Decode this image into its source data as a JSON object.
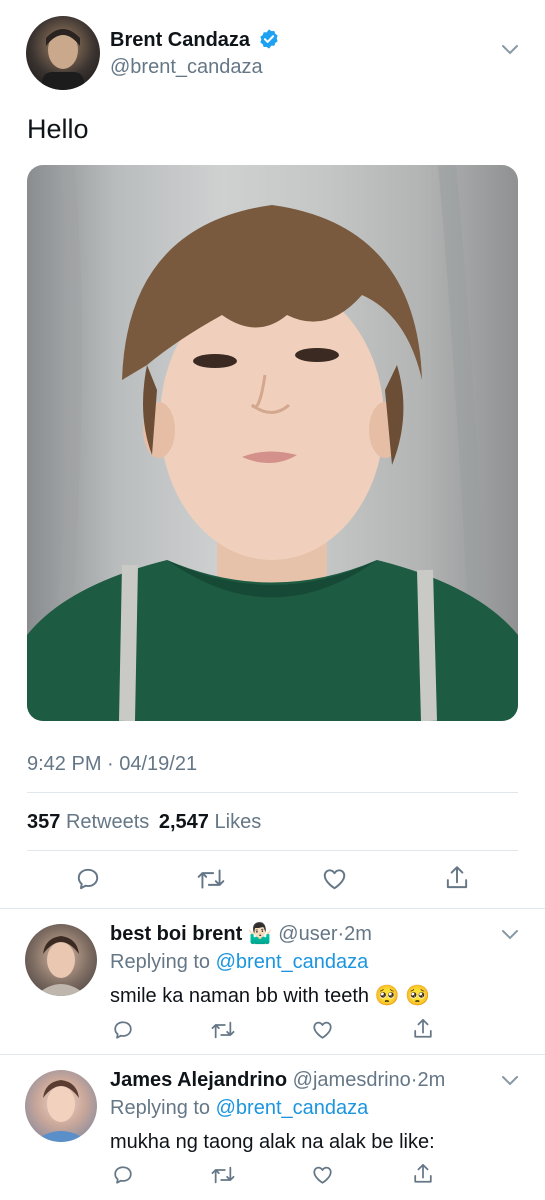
{
  "colors": {
    "accent": "#1b95e0",
    "verified": "#1da1f2",
    "text_secondary": "#657786",
    "divider": "#e1e8ed"
  },
  "main_tweet": {
    "display_name": "Brent Candaza",
    "handle": "@brent_candaza",
    "text": "Hello",
    "timestamp": "9:42 PM · 04/19/21",
    "retweets_count": "357",
    "retweets_label": "Retweets",
    "likes_count": "2,547",
    "likes_label": "Likes",
    "icons": [
      "reply-icon",
      "retweet-icon",
      "like-icon",
      "share-icon"
    ]
  },
  "replies": [
    {
      "display_name": "best boi brent",
      "emoji": "🤷🏻‍♂️",
      "handle": "@user",
      "separator": "·",
      "time": "2m",
      "replying_prefix": "Replying to",
      "replying_to": "@brent_candaza",
      "text": "smile ka naman bb with teeth",
      "text_emoji": "🥺 🥺"
    },
    {
      "display_name": "James Alejandrino",
      "handle": "@jamesdrino",
      "separator": "·",
      "time": "2m",
      "replying_prefix": "Replying to",
      "replying_to": "@brent_candaza",
      "text": "mukha ng taong alak na alak be like:"
    }
  ]
}
